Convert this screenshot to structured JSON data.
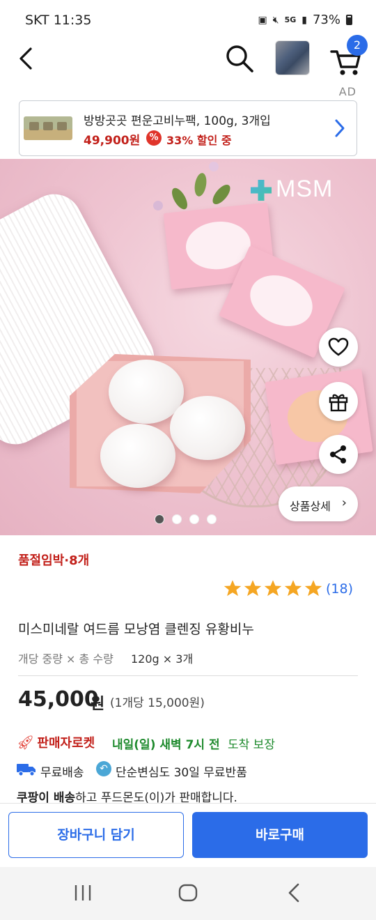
{
  "status_bar": {
    "carrier_time": "SKT 11:35",
    "network": "5G",
    "battery": "73%",
    "icons": [
      "lock-icon",
      "mute-icon",
      "wifi-icon",
      "signal-icon",
      "battery-icon"
    ]
  },
  "header": {
    "cart_count": "2",
    "icons": [
      "back-icon",
      "search-icon",
      "cart-icon"
    ]
  },
  "ad": {
    "tag": "AD",
    "title": "방방곳곳 편운고비누팩, 100g, 3개입",
    "price": "49,900원",
    "discount_icon": "%",
    "discount": "33% 할인 중"
  },
  "hero": {
    "brand_logo_text": "MSM",
    "detail_button": "상품상세",
    "detail_chevron": "›",
    "carousel": {
      "total": 4,
      "active": 1
    }
  },
  "product": {
    "stock_notice": "품절임박·8개",
    "rating": 5,
    "review_count": "(18)",
    "name": "미스미네랄 여드름 모낭염 클렌징 유황비누",
    "spec_label": "개당 중량 × 총 수량",
    "spec_value": "120g × 3개",
    "price": "45,000",
    "price_currency": "원",
    "unit_price": "(1개당 15,000원)"
  },
  "delivery": {
    "rocket_label": "판매자로켓",
    "arrival_bold": "내일(일) 새벽 7시 전",
    "arrival_rest": "도착 보장",
    "free_shipping": "무료배송",
    "return_policy": "단순변심도 30일 무료반품",
    "seller_bold": "쿠팡이 배송",
    "seller_rest": "하고 푸드몬도(이)가 판매합니다."
  },
  "actions": {
    "add_to_cart": "장바구니 담기",
    "buy_now": "바로구매"
  },
  "colors": {
    "primary": "#2b6ce8",
    "sale_red": "#c2201a",
    "arrival_green": "#1e8a2d",
    "star": "#f5a623"
  }
}
